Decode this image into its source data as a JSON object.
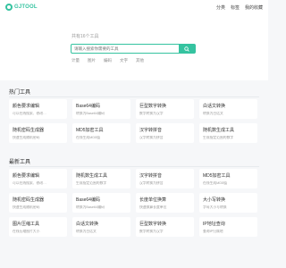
{
  "header": {
    "logo_text": "GJTOOL",
    "nav": [
      "分类",
      "标签",
      "我的收藏"
    ]
  },
  "hero": {
    "hint": "共有16个工具",
    "search_placeholder": "请输入搜索你需要的工具",
    "categories": [
      "计量",
      "图片",
      "编码",
      "文字",
      "其他"
    ]
  },
  "hot": {
    "title": "热门工具",
    "items": [
      {
        "title": "颜色要求编辑",
        "desc": "可以在线搜索、修改…"
      },
      {
        "title": "Base64编码",
        "desc": "转换为Base64编码"
      },
      {
        "title": "巨型数字转换",
        "desc": "数字转换为汉字"
      },
      {
        "title": "白话文转换",
        "desc": "转换为白话文"
      },
      {
        "title": "随机密码生成器",
        "desc": "快速生成随机密码"
      },
      {
        "title": "MD5加密工具",
        "desc": "在线生成MD5值"
      },
      {
        "title": "汉字转拼音",
        "desc": "汉字转换为拼音"
      },
      {
        "title": "随机数生成工具",
        "desc": "生成指定范围的数字"
      }
    ]
  },
  "latest": {
    "title": "最新工具",
    "items": [
      {
        "title": "颜色要求编辑",
        "desc": "可以在线搜索、修改…"
      },
      {
        "title": "随机数生成工具",
        "desc": "生成指定范围的数字"
      },
      {
        "title": "汉字转拼音",
        "desc": "汉字转换为拼音"
      },
      {
        "title": "MD5加密工具",
        "desc": "在线生成MD5值"
      },
      {
        "title": "随机密码生成器",
        "desc": "快速生成随机密码"
      },
      {
        "title": "Base64编码",
        "desc": "转换为Base64编码"
      },
      {
        "title": "长度单位换算",
        "desc": "快速换算长度单位"
      },
      {
        "title": "大小写转换",
        "desc": "字母大小写转换"
      },
      {
        "title": "图片压缩工具",
        "desc": "在线压缩图片大小"
      },
      {
        "title": "白话文转换",
        "desc": "转换为白话文"
      },
      {
        "title": "巨型数字转换",
        "desc": "数字转换为汉字"
      },
      {
        "title": "IP地址查询",
        "desc": "查询IP归属地"
      }
    ]
  }
}
